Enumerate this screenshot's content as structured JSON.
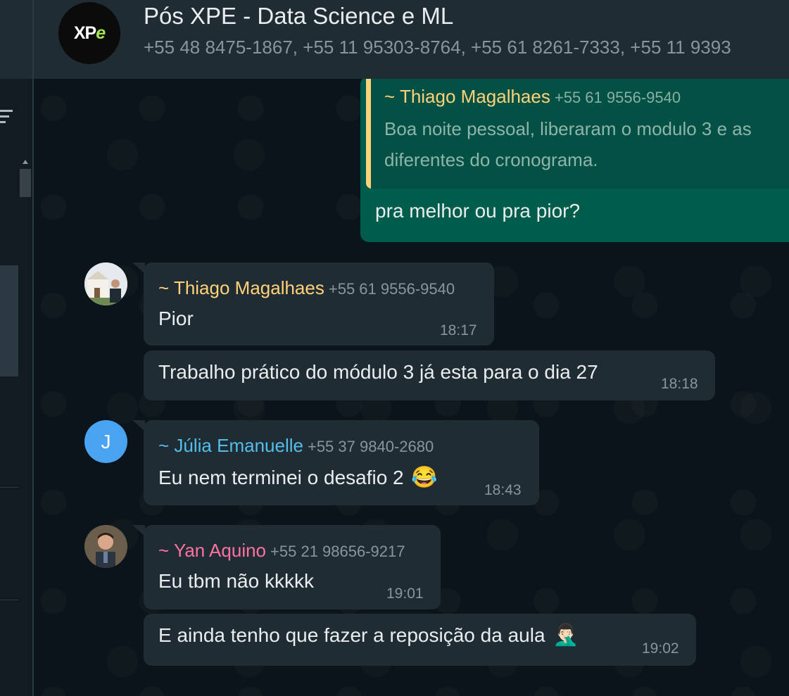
{
  "header": {
    "group_title": "Pós XPE - Data Science e ML",
    "members": "+55 48 8475-1867, +55 11 95303-8764, +55 61 8261-7333, +55 11 9393",
    "avatar_logo_xp": "XP",
    "avatar_logo_e": "e"
  },
  "messages": {
    "outgoing": {
      "quote_author": "~ Thiago Magalhaes",
      "quote_phone": "+55 61 9556-9540",
      "quote_line1": "Boa noite pessoal, liberaram o modulo 3 e as",
      "quote_line2": "diferentes do cronograma.",
      "text": "pra melhor ou pra pior?"
    },
    "thiago_1": {
      "name": "~ Thiago Magalhaes",
      "phone": "+55 61 9556-9540",
      "text": "Pior",
      "time": "18:17"
    },
    "thiago_2": {
      "text": "Trabalho prático do módulo 3 já esta para o dia 27",
      "time": "18:18"
    },
    "julia": {
      "avatar_letter": "J",
      "name": "~ Júlia Emanuelle",
      "phone": "+55 37 9840-2680",
      "text": "Eu nem terminei o desafio 2",
      "emoji": "😂",
      "time": "18:43"
    },
    "yan_1": {
      "name": "~ Yan Aquino",
      "phone": "+55 21 98656-9217",
      "text": "Eu tbm não kkkkk",
      "time": "19:01"
    },
    "yan_2": {
      "text": "E ainda tenho que fazer a reposição da aula",
      "emoji": "🤦🏻‍♂️",
      "time": "19:02"
    }
  },
  "colors": {
    "thiago_name": "#ffd279",
    "julia_name": "#53bdeb",
    "yan_name": "#ff72a1",
    "quote_bar": "#ffd279",
    "outgoing_bubble": "#005c4b",
    "incoming_bubble": "#202c33"
  }
}
